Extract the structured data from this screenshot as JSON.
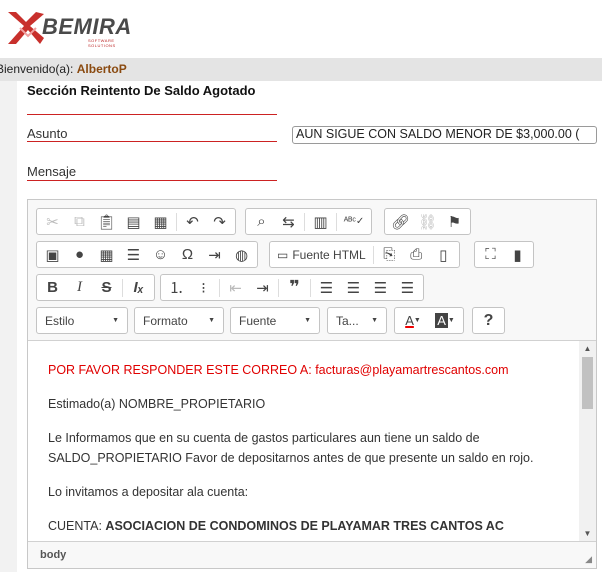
{
  "logo": {
    "brand": "BEMIRA",
    "tagline": "SOFTWARE SOLUTIONS"
  },
  "welcome": {
    "prefix": "Bienvenido(a):",
    "user": "AlbertoP"
  },
  "form": {
    "section_title": "Sección Reintento De Saldo Agotado",
    "asunto_label": "Asunto",
    "asunto_value": "AUN SIGUE CON SALDO MENOR DE $3,000.00 (",
    "mensaje_label": "Mensaje"
  },
  "toolbar": {
    "source_label": "Fuente HTML",
    "combos": {
      "estilo": "Estilo",
      "formato": "Formato",
      "fuente": "Fuente",
      "tamano": "Ta..."
    },
    "icons": [
      "cut-icon",
      "copy-icon",
      "paste-icon",
      "paste-text-icon",
      "paste-word-icon",
      "undo-icon",
      "redo-icon",
      "find-icon",
      "replace-icon",
      "select-all-icon",
      "spellcheck-icon",
      "link-icon",
      "unlink-icon",
      "anchor-icon",
      "image-icon",
      "flash-icon",
      "table-icon",
      "horizontal-rule-icon",
      "smiley-icon",
      "special-char-icon",
      "page-break-icon",
      "iframe-icon",
      "source-icon",
      "preview-icon",
      "print-icon",
      "templates-icon",
      "maximize-icon",
      "show-blocks-icon",
      "bold-icon",
      "italic-icon",
      "strike-icon",
      "remove-format-icon",
      "numbered-list-icon",
      "bulleted-list-icon",
      "outdent-icon",
      "indent-icon",
      "blockquote-icon",
      "align-left-icon",
      "align-center-icon",
      "align-right-icon",
      "justify-icon",
      "text-color-icon",
      "bg-color-icon",
      "help-icon"
    ]
  },
  "content": {
    "line1_prefix": "POR FAVOR RESPONDER ESTE CORREO A: ",
    "line1_email": "facturas@playamartrescantos.com",
    "line2": "Estimado(a) NOMBRE_PROPIETARIO",
    "line3a": "Le Informamos que en su cuenta de gastos particulares aun tiene un saldo de",
    "line3b": "SALDO_PROPIETARIO Favor de depositarnos antes de que presente un saldo en rojo.",
    "line4": "Lo invitamos a depositar ala cuenta:",
    "line5_prefix": "CUENTA: ",
    "line5_value": "ASOCIACION DE CONDOMINOS DE PLAYAMAR TRES CANTOS AC"
  },
  "statusbar": {
    "path": "body"
  },
  "colors": {
    "accent_red": "#cc2222",
    "content_red": "#e00000",
    "user_brown": "#8a4a10"
  }
}
